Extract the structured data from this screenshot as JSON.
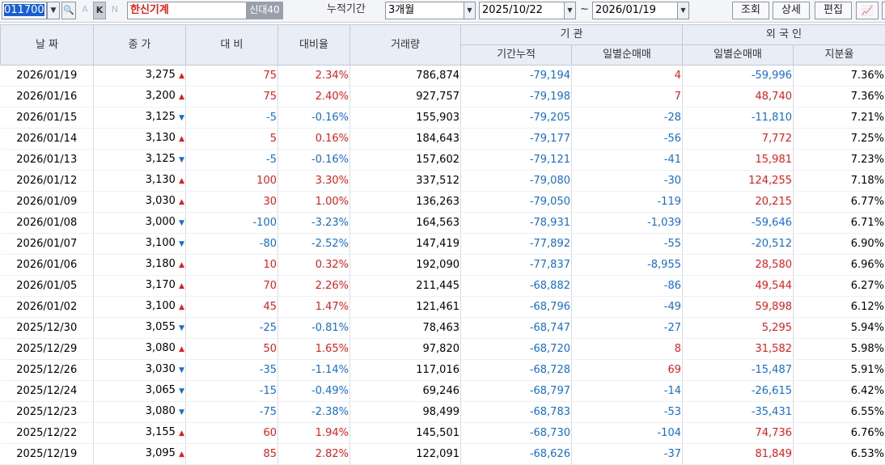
{
  "toolbar": {
    "code": "011700",
    "btn_a": "A",
    "btn_k": "K",
    "btn_n": "N",
    "stock_name": "한신기계",
    "credit_badge": "신대40",
    "period_label": "누적기간",
    "period_value": "3개월",
    "date_from": "2025/10/22",
    "date_sep": "~",
    "date_to": "2026/01/19",
    "query_label": "조회",
    "detail_label": "상세",
    "edit_label": "편집"
  },
  "headers": {
    "date": "날 짜",
    "close": "종 가",
    "change": "대 비",
    "change_rate": "대비율",
    "volume": "거래량",
    "institution": "기        관",
    "inst_cum": "기간누적",
    "inst_daily": "일별순매매",
    "foreign": "외 국 인",
    "for_daily": "일별순매매",
    "for_ratio": "지분율"
  },
  "rows": [
    {
      "date": "2026/01/19",
      "close": "3,275",
      "dir": "up",
      "change": "75",
      "rate": "2.34%",
      "volume": "786,874",
      "inst_cum": "-79,194",
      "inst_daily": "4",
      "for_daily": "-59,996",
      "ratio": "7.36%"
    },
    {
      "date": "2026/01/16",
      "close": "3,200",
      "dir": "up",
      "change": "75",
      "rate": "2.40%",
      "volume": "927,757",
      "inst_cum": "-79,198",
      "inst_daily": "7",
      "for_daily": "48,740",
      "ratio": "7.36%"
    },
    {
      "date": "2026/01/15",
      "close": "3,125",
      "dir": "dn",
      "change": "-5",
      "rate": "-0.16%",
      "volume": "155,903",
      "inst_cum": "-79,205",
      "inst_daily": "-28",
      "for_daily": "-11,810",
      "ratio": "7.21%"
    },
    {
      "date": "2026/01/14",
      "close": "3,130",
      "dir": "up",
      "change": "5",
      "rate": "0.16%",
      "volume": "184,643",
      "inst_cum": "-79,177",
      "inst_daily": "-56",
      "for_daily": "7,772",
      "ratio": "7.25%"
    },
    {
      "date": "2026/01/13",
      "close": "3,125",
      "dir": "dn",
      "change": "-5",
      "rate": "-0.16%",
      "volume": "157,602",
      "inst_cum": "-79,121",
      "inst_daily": "-41",
      "for_daily": "15,981",
      "ratio": "7.23%"
    },
    {
      "date": "2026/01/12",
      "close": "3,130",
      "dir": "up",
      "change": "100",
      "rate": "3.30%",
      "volume": "337,512",
      "inst_cum": "-79,080",
      "inst_daily": "-30",
      "for_daily": "124,255",
      "ratio": "7.18%"
    },
    {
      "date": "2026/01/09",
      "close": "3,030",
      "dir": "up",
      "change": "30",
      "rate": "1.00%",
      "volume": "136,263",
      "inst_cum": "-79,050",
      "inst_daily": "-119",
      "for_daily": "20,215",
      "ratio": "6.77%"
    },
    {
      "date": "2026/01/08",
      "close": "3,000",
      "dir": "dn",
      "change": "-100",
      "rate": "-3.23%",
      "volume": "164,563",
      "inst_cum": "-78,931",
      "inst_daily": "-1,039",
      "for_daily": "-59,646",
      "ratio": "6.71%"
    },
    {
      "date": "2026/01/07",
      "close": "3,100",
      "dir": "dn",
      "change": "-80",
      "rate": "-2.52%",
      "volume": "147,419",
      "inst_cum": "-77,892",
      "inst_daily": "-55",
      "for_daily": "-20,512",
      "ratio": "6.90%"
    },
    {
      "date": "2026/01/06",
      "close": "3,180",
      "dir": "up",
      "change": "10",
      "rate": "0.32%",
      "volume": "192,090",
      "inst_cum": "-77,837",
      "inst_daily": "-8,955",
      "for_daily": "28,580",
      "ratio": "6.96%"
    },
    {
      "date": "2026/01/05",
      "close": "3,170",
      "dir": "up",
      "change": "70",
      "rate": "2.26%",
      "volume": "211,445",
      "inst_cum": "-68,882",
      "inst_daily": "-86",
      "for_daily": "49,544",
      "ratio": "6.27%"
    },
    {
      "date": "2026/01/02",
      "close": "3,100",
      "dir": "up",
      "change": "45",
      "rate": "1.47%",
      "volume": "121,461",
      "inst_cum": "-68,796",
      "inst_daily": "-49",
      "for_daily": "59,898",
      "ratio": "6.12%"
    },
    {
      "date": "2025/12/30",
      "close": "3,055",
      "dir": "dn",
      "change": "-25",
      "rate": "-0.81%",
      "volume": "78,463",
      "inst_cum": "-68,747",
      "inst_daily": "-27",
      "for_daily": "5,295",
      "ratio": "5.94%"
    },
    {
      "date": "2025/12/29",
      "close": "3,080",
      "dir": "up",
      "change": "50",
      "rate": "1.65%",
      "volume": "97,820",
      "inst_cum": "-68,720",
      "inst_daily": "8",
      "for_daily": "31,582",
      "ratio": "5.98%"
    },
    {
      "date": "2025/12/26",
      "close": "3,030",
      "dir": "dn",
      "change": "-35",
      "rate": "-1.14%",
      "volume": "117,016",
      "inst_cum": "-68,728",
      "inst_daily": "69",
      "for_daily": "-15,487",
      "ratio": "5.91%"
    },
    {
      "date": "2025/12/24",
      "close": "3,065",
      "dir": "dn",
      "change": "-15",
      "rate": "-0.49%",
      "volume": "69,246",
      "inst_cum": "-68,797",
      "inst_daily": "-14",
      "for_daily": "-26,615",
      "ratio": "6.42%"
    },
    {
      "date": "2025/12/23",
      "close": "3,080",
      "dir": "dn",
      "change": "-75",
      "rate": "-2.38%",
      "volume": "98,499",
      "inst_cum": "-68,783",
      "inst_daily": "-53",
      "for_daily": "-35,431",
      "ratio": "6.55%"
    },
    {
      "date": "2025/12/22",
      "close": "3,155",
      "dir": "up",
      "change": "60",
      "rate": "1.94%",
      "volume": "145,501",
      "inst_cum": "-68,730",
      "inst_daily": "-104",
      "for_daily": "74,736",
      "ratio": "6.76%"
    },
    {
      "date": "2025/12/19",
      "close": "3,095",
      "dir": "up",
      "change": "85",
      "rate": "2.82%",
      "volume": "122,091",
      "inst_cum": "-68,626",
      "inst_daily": "-37",
      "for_daily": "81,849",
      "ratio": "6.53%"
    }
  ]
}
